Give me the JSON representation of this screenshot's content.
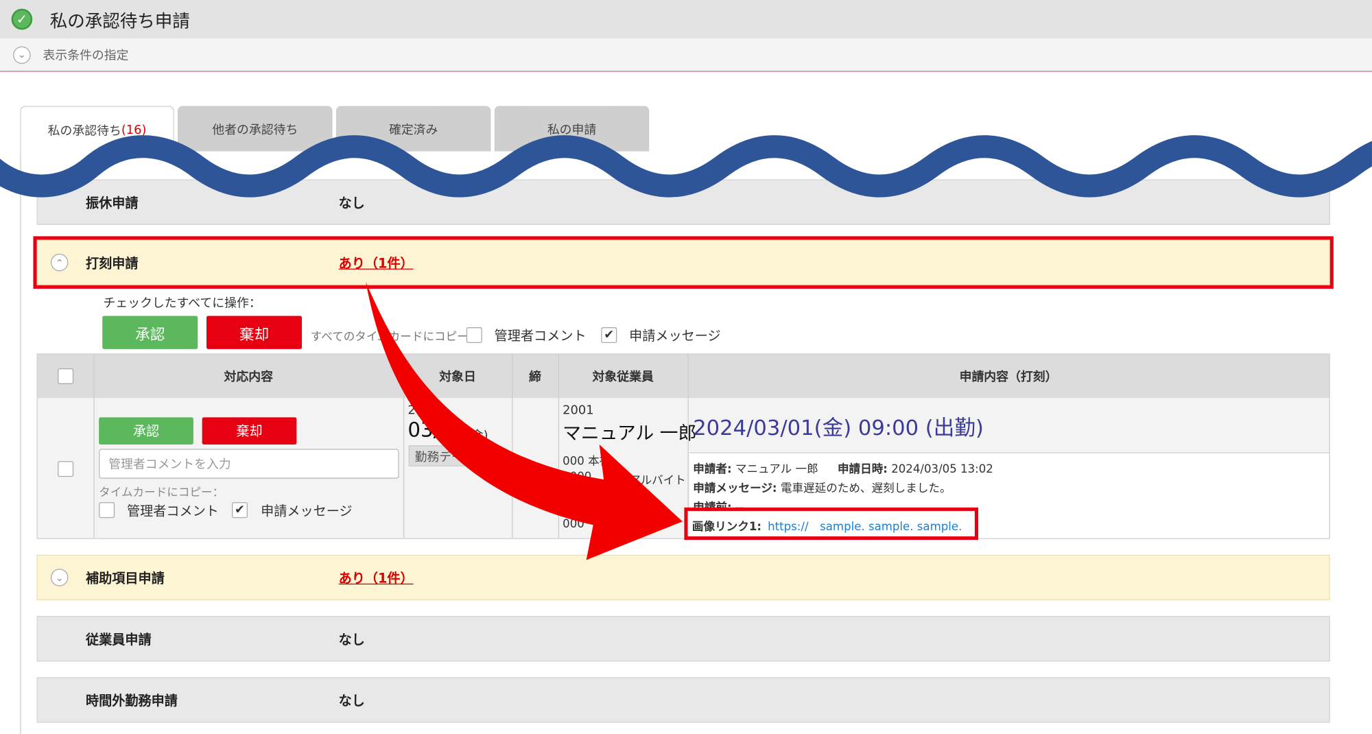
{
  "page": {
    "title": "私の承認待ち申請",
    "filter_label": "表示条件の指定"
  },
  "tabs": [
    {
      "label": "私の承認待ち",
      "count": "(16)"
    },
    {
      "label": "他者の承認待ち"
    },
    {
      "label": "確定済み"
    },
    {
      "label": "私の申請"
    }
  ],
  "sections": [
    {
      "name": "振休申請",
      "status": "なし"
    },
    {
      "name": "打刻申請",
      "status": "あり（1件）"
    },
    {
      "name": "補助項目申請",
      "status": "あり（1件）"
    },
    {
      "name": "従業員申請",
      "status": "なし"
    },
    {
      "name": "時間外勤務申請",
      "status": "なし"
    }
  ],
  "bulk": {
    "label": "チェックしたすべてに操作：",
    "approve": "承認",
    "reject": "棄却",
    "copy_label": "すべてのタイムカードにコピー：",
    "admin_comment": "管理者コメント",
    "request_message": "申請メッセージ"
  },
  "table": {
    "headers": {
      "action": "対応内容",
      "date": "対象日",
      "close": "締",
      "employee": "対象従業員",
      "content": "申請内容（打刻）"
    },
    "row": {
      "approve": "承認",
      "reject": "棄却",
      "comment_placeholder": "管理者コメントを入力",
      "copy_label": "タイムカードにコピー：",
      "admin_comment": "管理者コメント",
      "request_message": "申請メッセージ",
      "date_year": "202",
      "date_main": "03/0",
      "date_dow": "(金)",
      "work_data_btn": "勤務デー",
      "emp_code": "2001",
      "emp_name": "マニュアル 一郎",
      "dept_line1": "000 本社",
      "dept_line2": "2000",
      "dept_line2b": "アルバイト",
      "dept_line3": "000",
      "punch_headline": "2024/03/01(金) 09:00 (出勤)",
      "applicant_label": "申請者:",
      "applicant": "マニュアル 一郎",
      "applied_at_label": "申請日時:",
      "applied_at": "2024/03/05 13:02",
      "message_label": "申請メッセージ:",
      "message": "電車遅延のため、遅刻しました。",
      "before_label": "申請前:",
      "before": "--",
      "image_link_label": "画像リンク1:",
      "image_link": "https://　sample. sample. sample."
    }
  },
  "colors": {
    "accent_red": "#e60012",
    "approve_green": "#5cb85c",
    "wave_blue": "#2e5597",
    "link_blue": "#1a7fd4",
    "headline_blue": "#3b3b9a"
  }
}
